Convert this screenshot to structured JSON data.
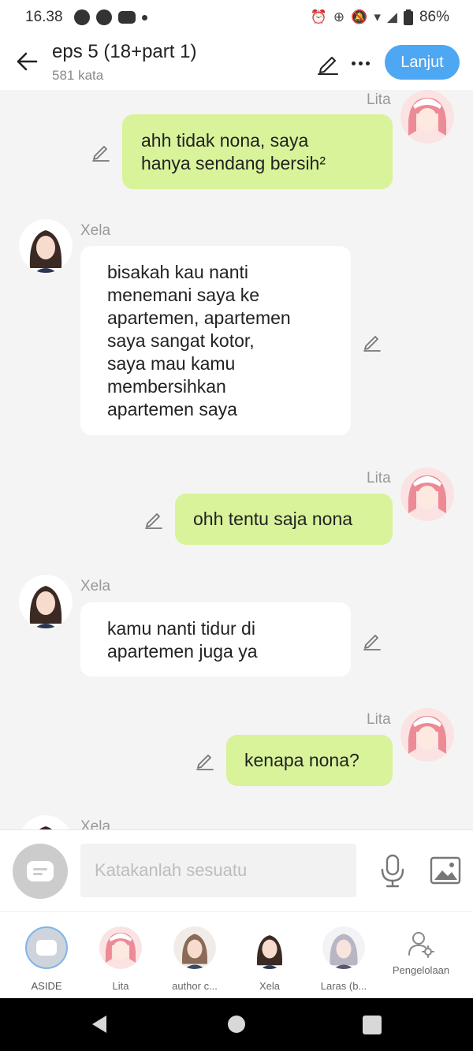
{
  "status": {
    "time": "16.38",
    "battery": "86%"
  },
  "header": {
    "title": "eps 5 (18+part 1)",
    "subtitle": "581 kata",
    "next_label": "Lanjut"
  },
  "messages": [
    {
      "speaker": "Lita",
      "side": "right",
      "lines": [
        "ahh tidak nona, saya",
        "hanya sendang bersih²"
      ]
    },
    {
      "speaker": "Xela",
      "side": "left",
      "lines": [
        "bisakah kau nanti",
        "menemani saya ke",
        "apartemen, apartemen",
        "saya sangat kotor,",
        "saya mau kamu",
        "membersihkan",
        "apartemen saya"
      ]
    },
    {
      "speaker": "Lita",
      "side": "right",
      "lines": [
        "ohh tentu saja nona"
      ]
    },
    {
      "speaker": "Xela",
      "side": "left",
      "lines": [
        "kamu nanti tidur di",
        "apartemen juga ya"
      ]
    },
    {
      "speaker": "Lita",
      "side": "right",
      "lines": [
        "kenapa nona?"
      ]
    },
    {
      "speaker": "Xela",
      "side": "left",
      "lines": []
    }
  ],
  "input": {
    "placeholder": "Katakanlah sesuatu"
  },
  "characters": [
    {
      "label": "ASIDE"
    },
    {
      "label": "Lita"
    },
    {
      "label": "author c..."
    },
    {
      "label": "Xela"
    },
    {
      "label": "Laras (b..."
    },
    {
      "label": "Pengelolaan"
    }
  ],
  "colors": {
    "accent": "#4ea7f2",
    "bubble_right": "#d8f39a",
    "bubble_left": "#ffffff",
    "background": "#f4f4f4"
  }
}
